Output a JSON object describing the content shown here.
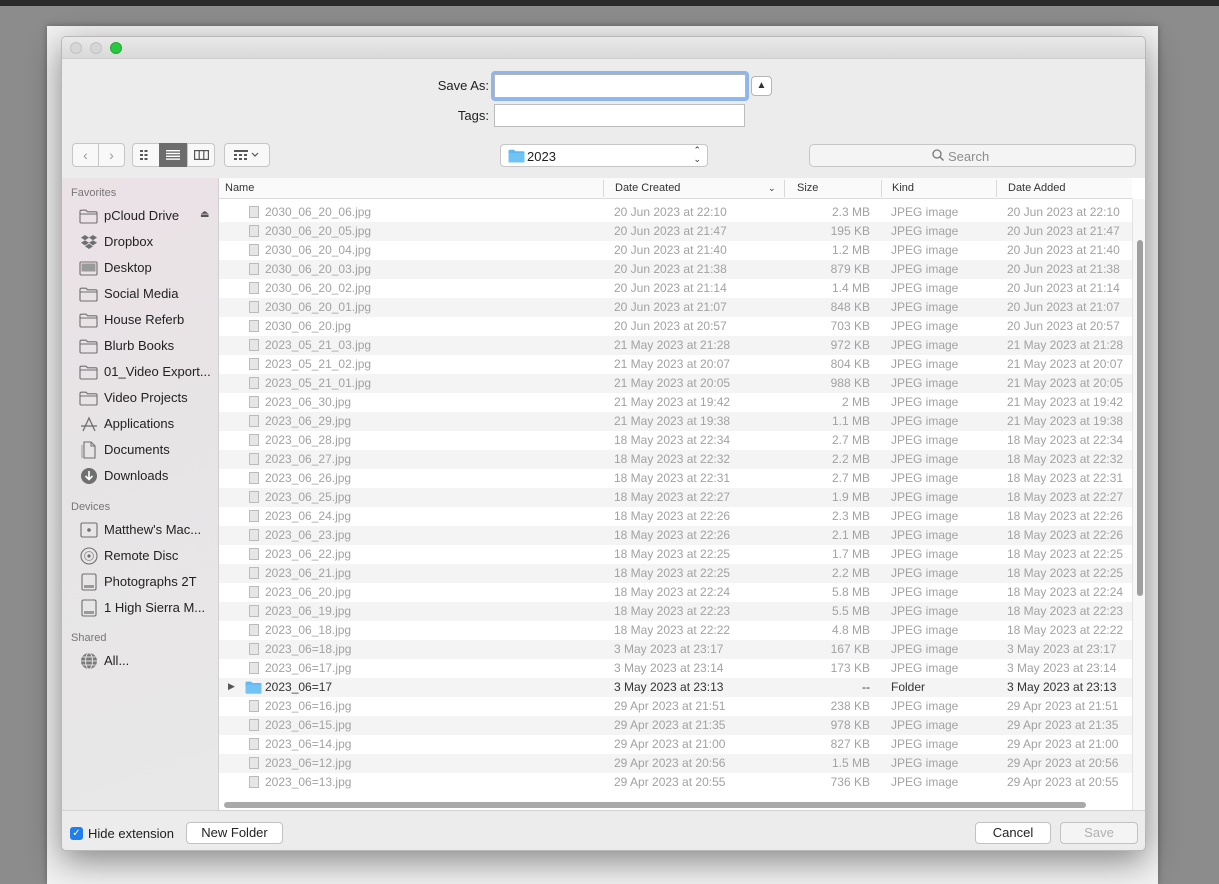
{
  "window": {
    "traffic_lights": [
      "close",
      "minimize",
      "zoom"
    ]
  },
  "form": {
    "save_as_label": "Save As:",
    "save_as_value": "",
    "tags_label": "Tags:",
    "tags_value": ""
  },
  "toolbar": {
    "back": "‹",
    "forward": "›",
    "path": "2023",
    "search_placeholder": "Search"
  },
  "sidebar": {
    "favorites_header": "Favorites",
    "favorites": [
      {
        "label": "pCloud Drive",
        "icon": "folder-icon"
      },
      {
        "label": "Dropbox",
        "icon": "dropbox-icon"
      },
      {
        "label": "Desktop",
        "icon": "desktop-icon"
      },
      {
        "label": "Social Media",
        "icon": "folder-icon"
      },
      {
        "label": "House Referb",
        "icon": "folder-icon"
      },
      {
        "label": "Blurb Books",
        "icon": "folder-icon"
      },
      {
        "label": "01_Video Export...",
        "icon": "folder-icon"
      },
      {
        "label": "Video Projects",
        "icon": "folder-icon"
      },
      {
        "label": "Applications",
        "icon": "applications-icon"
      },
      {
        "label": "Documents",
        "icon": "documents-icon"
      },
      {
        "label": "Downloads",
        "icon": "downloads-icon"
      }
    ],
    "devices_header": "Devices",
    "devices": [
      {
        "label": "Matthew's Mac...",
        "icon": "computer-icon"
      },
      {
        "label": "Remote Disc",
        "icon": "disc-icon"
      },
      {
        "label": "Photographs 2T",
        "icon": "drive-icon"
      },
      {
        "label": "1 High Sierra M...",
        "icon": "drive-icon"
      }
    ],
    "shared_header": "Shared",
    "shared": [
      {
        "label": "All...",
        "icon": "network-icon"
      }
    ]
  },
  "columns": {
    "name": "Name",
    "date_created": "Date Created",
    "size": "Size",
    "kind": "Kind",
    "date_added": "Date Added"
  },
  "files": [
    {
      "name": "2030_06_20_06.jpg",
      "created": "20 Jun 2023 at 22:10",
      "size": "2.3 MB",
      "kind": "JPEG image",
      "added": "20 Jun 2023 at 22:10"
    },
    {
      "name": "2030_06_20_05.jpg",
      "created": "20 Jun 2023 at 21:47",
      "size": "195 KB",
      "kind": "JPEG image",
      "added": "20 Jun 2023 at 21:47"
    },
    {
      "name": "2030_06_20_04.jpg",
      "created": "20 Jun 2023 at 21:40",
      "size": "1.2 MB",
      "kind": "JPEG image",
      "added": "20 Jun 2023 at 21:40"
    },
    {
      "name": "2030_06_20_03.jpg",
      "created": "20 Jun 2023 at 21:38",
      "size": "879 KB",
      "kind": "JPEG image",
      "added": "20 Jun 2023 at 21:38"
    },
    {
      "name": "2030_06_20_02.jpg",
      "created": "20 Jun 2023 at 21:14",
      "size": "1.4 MB",
      "kind": "JPEG image",
      "added": "20 Jun 2023 at 21:14"
    },
    {
      "name": "2030_06_20_01.jpg",
      "created": "20 Jun 2023 at 21:07",
      "size": "848 KB",
      "kind": "JPEG image",
      "added": "20 Jun 2023 at 21:07"
    },
    {
      "name": "2030_06_20.jpg",
      "created": "20 Jun 2023 at 20:57",
      "size": "703 KB",
      "kind": "JPEG image",
      "added": "20 Jun 2023 at 20:57"
    },
    {
      "name": "2023_05_21_03.jpg",
      "created": "21 May 2023 at 21:28",
      "size": "972 KB",
      "kind": "JPEG image",
      "added": "21 May 2023 at 21:28"
    },
    {
      "name": "2023_05_21_02.jpg",
      "created": "21 May 2023 at 20:07",
      "size": "804 KB",
      "kind": "JPEG image",
      "added": "21 May 2023 at 20:07"
    },
    {
      "name": "2023_05_21_01.jpg",
      "created": "21 May 2023 at 20:05",
      "size": "988 KB",
      "kind": "JPEG image",
      "added": "21 May 2023 at 20:05"
    },
    {
      "name": "2023_06_30.jpg",
      "created": "21 May 2023 at 19:42",
      "size": "2 MB",
      "kind": "JPEG image",
      "added": "21 May 2023 at 19:42"
    },
    {
      "name": "2023_06_29.jpg",
      "created": "21 May 2023 at 19:38",
      "size": "1.1 MB",
      "kind": "JPEG image",
      "added": "21 May 2023 at 19:38"
    },
    {
      "name": "2023_06_28.jpg",
      "created": "18 May 2023 at 22:34",
      "size": "2.7 MB",
      "kind": "JPEG image",
      "added": "18 May 2023 at 22:34"
    },
    {
      "name": "2023_06_27.jpg",
      "created": "18 May 2023 at 22:32",
      "size": "2.2 MB",
      "kind": "JPEG image",
      "added": "18 May 2023 at 22:32"
    },
    {
      "name": "2023_06_26.jpg",
      "created": "18 May 2023 at 22:31",
      "size": "2.7 MB",
      "kind": "JPEG image",
      "added": "18 May 2023 at 22:31"
    },
    {
      "name": "2023_06_25.jpg",
      "created": "18 May 2023 at 22:27",
      "size": "1.9 MB",
      "kind": "JPEG image",
      "added": "18 May 2023 at 22:27"
    },
    {
      "name": "2023_06_24.jpg",
      "created": "18 May 2023 at 22:26",
      "size": "2.3 MB",
      "kind": "JPEG image",
      "added": "18 May 2023 at 22:26"
    },
    {
      "name": "2023_06_23.jpg",
      "created": "18 May 2023 at 22:26",
      "size": "2.1 MB",
      "kind": "JPEG image",
      "added": "18 May 2023 at 22:26"
    },
    {
      "name": "2023_06_22.jpg",
      "created": "18 May 2023 at 22:25",
      "size": "1.7 MB",
      "kind": "JPEG image",
      "added": "18 May 2023 at 22:25"
    },
    {
      "name": "2023_06_21.jpg",
      "created": "18 May 2023 at 22:25",
      "size": "2.2 MB",
      "kind": "JPEG image",
      "added": "18 May 2023 at 22:25"
    },
    {
      "name": "2023_06_20.jpg",
      "created": "18 May 2023 at 22:24",
      "size": "5.8 MB",
      "kind": "JPEG image",
      "added": "18 May 2023 at 22:24"
    },
    {
      "name": "2023_06_19.jpg",
      "created": "18 May 2023 at 22:23",
      "size": "5.5 MB",
      "kind": "JPEG image",
      "added": "18 May 2023 at 22:23"
    },
    {
      "name": "2023_06_18.jpg",
      "created": "18 May 2023 at 22:22",
      "size": "4.8 MB",
      "kind": "JPEG image",
      "added": "18 May 2023 at 22:22"
    },
    {
      "name": "2023_06=18.jpg",
      "created": "3 May 2023 at 23:17",
      "size": "167 KB",
      "kind": "JPEG image",
      "added": "3 May 2023 at 23:17"
    },
    {
      "name": "2023_06=17.jpg",
      "created": "3 May 2023 at 23:14",
      "size": "173 KB",
      "kind": "JPEG image",
      "added": "3 May 2023 at 23:14"
    },
    {
      "name": "2023_06=17",
      "created": "3 May 2023 at 23:13",
      "size": "--",
      "kind": "Folder",
      "added": "3 May 2023 at 23:13",
      "is_folder": true
    },
    {
      "name": "2023_06=16.jpg",
      "created": "29 Apr 2023 at 21:51",
      "size": "238 KB",
      "kind": "JPEG image",
      "added": "29 Apr 2023 at 21:51"
    },
    {
      "name": "2023_06=15.jpg",
      "created": "29 Apr 2023 at 21:35",
      "size": "978 KB",
      "kind": "JPEG image",
      "added": "29 Apr 2023 at 21:35"
    },
    {
      "name": "2023_06=14.jpg",
      "created": "29 Apr 2023 at 21:00",
      "size": "827 KB",
      "kind": "JPEG image",
      "added": "29 Apr 2023 at 21:00"
    },
    {
      "name": "2023_06=12.jpg",
      "created": "29 Apr 2023 at 20:56",
      "size": "1.5 MB",
      "kind": "JPEG image",
      "added": "29 Apr 2023 at 20:56"
    },
    {
      "name": "2023_06=13.jpg",
      "created": "29 Apr 2023 at 20:55",
      "size": "736 KB",
      "kind": "JPEG image",
      "added": "29 Apr 2023 at 20:55"
    }
  ],
  "bottom": {
    "hide_extension_label": "Hide extension",
    "hide_extension_checked": true,
    "new_folder": "New Folder",
    "cancel": "Cancel",
    "save": "Save"
  },
  "colors": {
    "accent": "#1f7ef0",
    "folder": "#5fb8f2",
    "zoom_light": "#28c840"
  }
}
